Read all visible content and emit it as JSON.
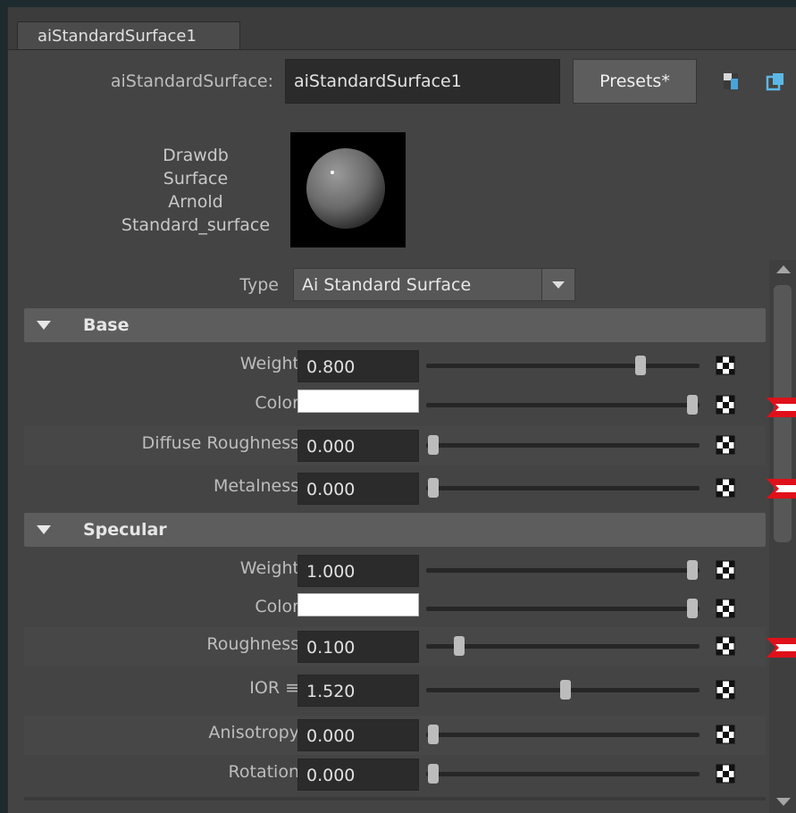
{
  "tab": {
    "label": "aiStandardSurface1"
  },
  "node": {
    "type_label": "aiStandardSurface:",
    "name_value": "aiStandardSurface1"
  },
  "toolbar": {
    "presets_label": "Presets*",
    "icons": [
      "focus-icon",
      "copy-tab-icon"
    ]
  },
  "swatch": {
    "label_lines": [
      "Drawdb",
      "Surface",
      "Arnold",
      "Standard_surface"
    ]
  },
  "type_select": {
    "label": "Type",
    "value": "Ai Standard Surface"
  },
  "sections": {
    "base": {
      "title": "Base",
      "rows": {
        "weight": {
          "label": "Weight",
          "value": "0.800",
          "slider": 0.8
        },
        "color": {
          "label": "Color",
          "color": "#ffffff",
          "slider": 1.0
        },
        "diffuse": {
          "label": "Diffuse Roughness",
          "value": "0.000",
          "slider": 0.0
        },
        "metal": {
          "label": "Metalness",
          "value": "0.000",
          "slider": 0.0
        }
      }
    },
    "specular": {
      "title": "Specular",
      "rows": {
        "weight": {
          "label": "Weight",
          "value": "1.000",
          "slider": 1.0
        },
        "color": {
          "label": "Color",
          "color": "#ffffff",
          "slider": 1.0
        },
        "roughness": {
          "label": "Roughness",
          "value": "0.100",
          "slider": 0.1
        },
        "ior": {
          "label": "IOR ≡",
          "value": "1.520",
          "slider": 0.51
        },
        "anisotropy": {
          "label": "Anisotropy",
          "value": "0.000",
          "slider": 0.0
        },
        "rotation": {
          "label": "Rotation",
          "value": "0.000",
          "slider": 0.0
        }
      }
    }
  },
  "colors": {
    "marker": "#e0101a",
    "panel": "#444444",
    "header": "#5d5d5d"
  }
}
